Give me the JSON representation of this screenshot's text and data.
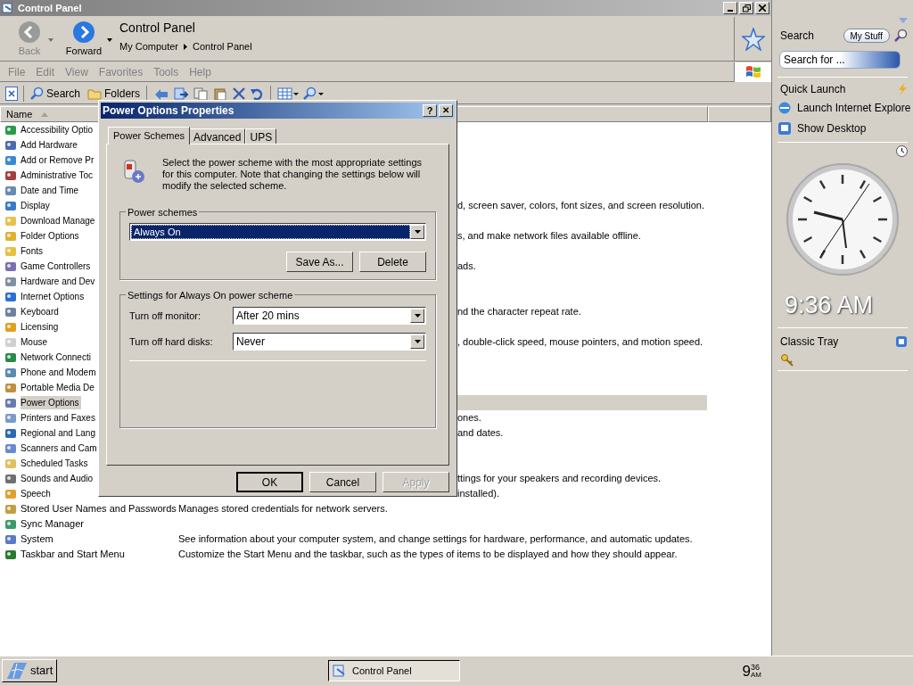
{
  "window": {
    "title": "Control Panel"
  },
  "nav": {
    "back": {
      "label": "Back",
      "disabled": true
    },
    "forward": {
      "label": "Forward",
      "disabled": false
    },
    "location_title": "Control Panel",
    "breadcrumb": [
      "My Computer",
      "Control Panel"
    ]
  },
  "menu": [
    "File",
    "Edit",
    "View",
    "Favorites",
    "Tools",
    "Help"
  ],
  "toolbar": {
    "search": "Search",
    "folders": "Folders"
  },
  "list": {
    "column": "Name",
    "items": [
      {
        "name": "Accessibility Optio",
        "selected": false
      },
      {
        "name": "Add Hardware",
        "selected": false
      },
      {
        "name": "Add or Remove Pr",
        "selected": false
      },
      {
        "name": "Administrative Toc",
        "selected": false
      },
      {
        "name": "Date and Time",
        "selected": false
      },
      {
        "name": "Display",
        "selected": false,
        "description": "d, screen saver, colors, font sizes, and screen resolution."
      },
      {
        "name": "Download Manage",
        "selected": false
      },
      {
        "name": "Folder Options",
        "selected": false,
        "description": "s, and make network files available offline."
      },
      {
        "name": "Fonts",
        "selected": false
      },
      {
        "name": "Game Controllers",
        "selected": false,
        "description": "ads."
      },
      {
        "name": "Hardware and Dev",
        "selected": false
      },
      {
        "name": "Internet Options",
        "selected": false
      },
      {
        "name": "Keyboard",
        "selected": false,
        "description": "nd the character repeat rate."
      },
      {
        "name": "Licensing",
        "selected": false
      },
      {
        "name": "Mouse",
        "selected": false,
        "description": ", double-click speed, mouse pointers, and motion speed."
      },
      {
        "name": "Network Connecti",
        "selected": false
      },
      {
        "name": "Phone and Modem",
        "selected": false
      },
      {
        "name": "Portable Media De",
        "selected": false
      },
      {
        "name": "Power Options",
        "selected": true
      },
      {
        "name": "Printers and Faxes",
        "selected": false,
        "description": "ones."
      },
      {
        "name": "Regional and Lang",
        "selected": false,
        "description": "and dates."
      },
      {
        "name": "Scanners and Cam",
        "selected": false
      },
      {
        "name": "Scheduled Tasks",
        "selected": false
      },
      {
        "name": "Sounds and Audio",
        "selected": false,
        "description": "ttings for your speakers and recording devices."
      },
      {
        "name": "Speech",
        "selected": false,
        "description": "installed)."
      },
      {
        "name": "Stored User Names and Passwords",
        "selected": false,
        "description": "Manages stored credentials for network servers."
      },
      {
        "name": "Sync Manager",
        "selected": false
      },
      {
        "name": "System",
        "selected": false,
        "description": "See information about your computer system, and change settings for hardware, performance, and automatic updates."
      },
      {
        "name": "Taskbar and Start Menu",
        "selected": false,
        "description": "Customize the Start Menu and the taskbar, such as the types of items to be displayed and how they should appear."
      }
    ]
  },
  "dialog": {
    "title": "Power Options Properties",
    "help": "?",
    "close": "✕",
    "tabs": [
      {
        "label": "Power Schemes",
        "selected": true
      },
      {
        "label": "Advanced",
        "selected": false
      },
      {
        "label": "UPS",
        "selected": false
      }
    ],
    "intro": "Select the power scheme with the most appropriate settings for this computer. Note that changing the settings below will modify the selected scheme.",
    "schemes_group": {
      "legend": "Power schemes",
      "value": "Always On",
      "buttons": [
        "Save As...",
        "Delete"
      ]
    },
    "settings_group": {
      "legend": "Settings for Always On power scheme",
      "rows": [
        {
          "label": "Turn off monitor:",
          "value": "After 20 mins"
        },
        {
          "label": "Turn off hard disks:",
          "value": "Never"
        }
      ]
    },
    "buttons": [
      {
        "label": "OK",
        "default": true,
        "disabled": false
      },
      {
        "label": "Cancel",
        "default": false,
        "disabled": false
      },
      {
        "label": "Apply",
        "default": false,
        "disabled": true
      }
    ]
  },
  "sidebar": {
    "search_title": "Search",
    "my_stuff": "My Stuff",
    "search_placeholder": "Search for ...",
    "quick_launch": {
      "title": "Quick Launch",
      "items": [
        "Launch Internet Explore",
        "Show Desktop"
      ]
    },
    "clock_time": "9:36 AM",
    "classic_tray": "Classic Tray"
  },
  "taskbar": {
    "start": "start",
    "task": "Control Panel",
    "clock_hour": "9",
    "clock_minutes": "36",
    "clock_ampm": "AM"
  }
}
